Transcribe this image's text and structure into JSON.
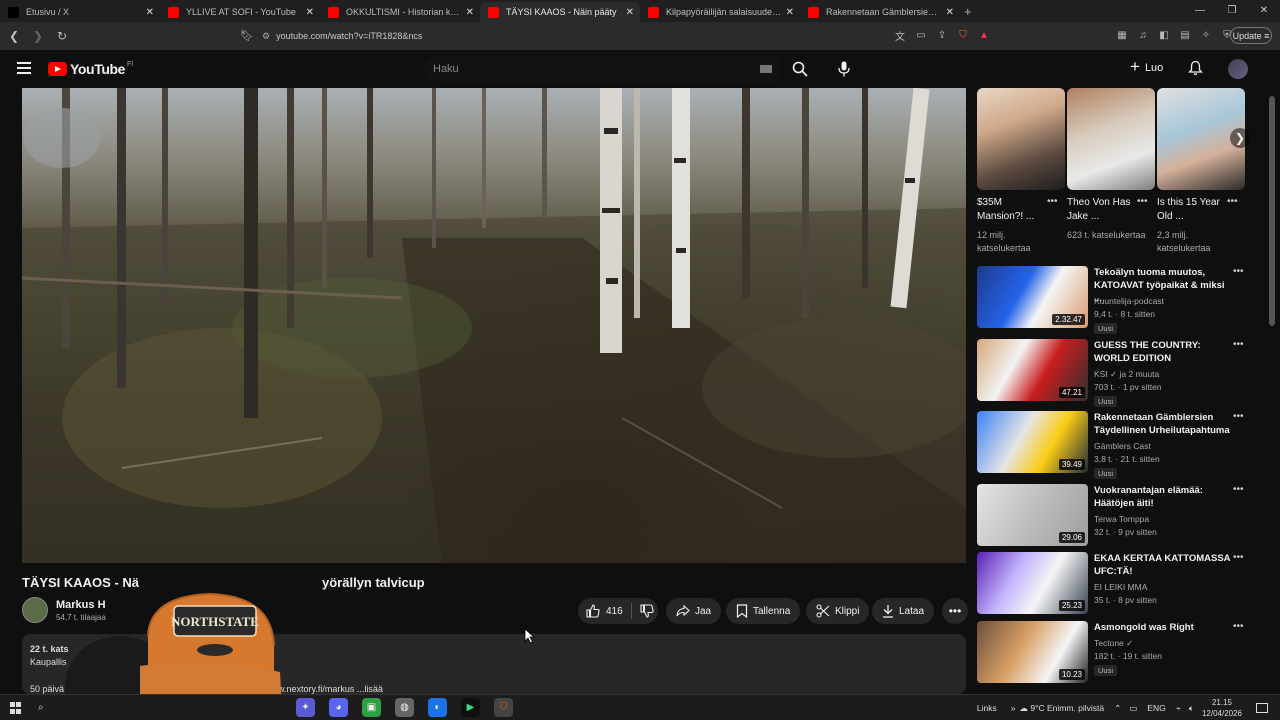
{
  "browser": {
    "tabs": [
      {
        "title": "Etusivu / X",
        "color": "#000000",
        "active": false
      },
      {
        "title": "YLLIVE AT SOFI - YouTube",
        "color": "#ff0000",
        "active": false
      },
      {
        "title": "OKKULTISMI - Historian kylätty totuus",
        "color": "#ff0000",
        "active": false
      },
      {
        "title": "TÄYSI KAAOS - Näin pääty",
        "color": "#ff0000",
        "active": true
      },
      {
        "title": "Kilpapyöräilijän salaisuudet: Näin pi",
        "color": "#ff0000",
        "active": false
      },
      {
        "title": "Rakennetaan Gämblersien Täydellinen",
        "color": "#ff0000",
        "active": false
      }
    ],
    "url": "youtube.com/watch?v=iTR1828&ncs",
    "update_label": "Update"
  },
  "masthead": {
    "logo_text": "YouTube",
    "region": "FI",
    "search_placeholder": "Haku",
    "create_label": "Luo"
  },
  "video": {
    "title_visible_left": "TÄYSI KAAOS - Nä",
    "title_visible_right": "yörällyn talvicup",
    "channel": "Markus H",
    "subs": "54,7 t. tilaajaa",
    "likes": "416",
    "share_label": "Jaa",
    "save_label": "Tallenna",
    "clip_label": "Klippi",
    "download_label": "Lataa"
  },
  "description": {
    "line1": "22 t. kats",
    "line2": "Kaupallis",
    "line3": "50 päivä",
    "link_fragment": "w.nextory.fi/markus ...lisää"
  },
  "shorts": [
    {
      "title": "$35M Mansion?! ...",
      "views": "12 milj. katselukertaa"
    },
    {
      "title": "Theo Von Has Jake ...",
      "views": "623 t. katselukertaa"
    },
    {
      "title": "Is this 15 Year Old ...",
      "views": "2,3 milj. katselukertaa"
    }
  ],
  "recommendations": [
    {
      "title": "Tekoälyn tuoma muutos, KATOAVAT työpaikat & miksi ...",
      "channel": "Kuuntelija-podcast",
      "meta": "9,4 t. · 8 t. sitten",
      "badge": "Uusi",
      "duration": "2.32.47"
    },
    {
      "title": "GUESS THE COUNTRY: WORLD EDITION",
      "channel": "KSI ✓ ja 2 muuta",
      "meta": "703 t. · 1 pv sitten",
      "badge": "Uusi",
      "duration": "47.21"
    },
    {
      "title": "Rakennetaan Gämblersien Täydellinen Urheilutapahtuma",
      "channel": "Gämblers Cast",
      "meta": "3,8 t. · 21 t. sitten",
      "badge": "Uusi",
      "duration": "39.49"
    },
    {
      "title": "Vuokranantajan elämää: Häätöjen äiti!",
      "channel": "Terwa Tomppa",
      "meta": "32 t. · 9 pv sitten",
      "badge": "",
      "duration": "29.06"
    },
    {
      "title": "EKAA KERTAA KATTOMASSA UFC:TÄ!",
      "channel": "EI LEIKI MMA",
      "meta": "35 t. · 8 pv sitten",
      "badge": "",
      "duration": "25.23"
    },
    {
      "title": "Asmongold was Right",
      "channel": "Tectone ✓",
      "meta": "182 t. · 19 t. sitten",
      "badge": "Uusi",
      "duration": "10.23"
    }
  ],
  "taskbar": {
    "links_label": "Links",
    "weather": "9°C Enimm. pilvistä",
    "lang": "ENG",
    "time": "21.15",
    "date": "12/04/2026"
  }
}
